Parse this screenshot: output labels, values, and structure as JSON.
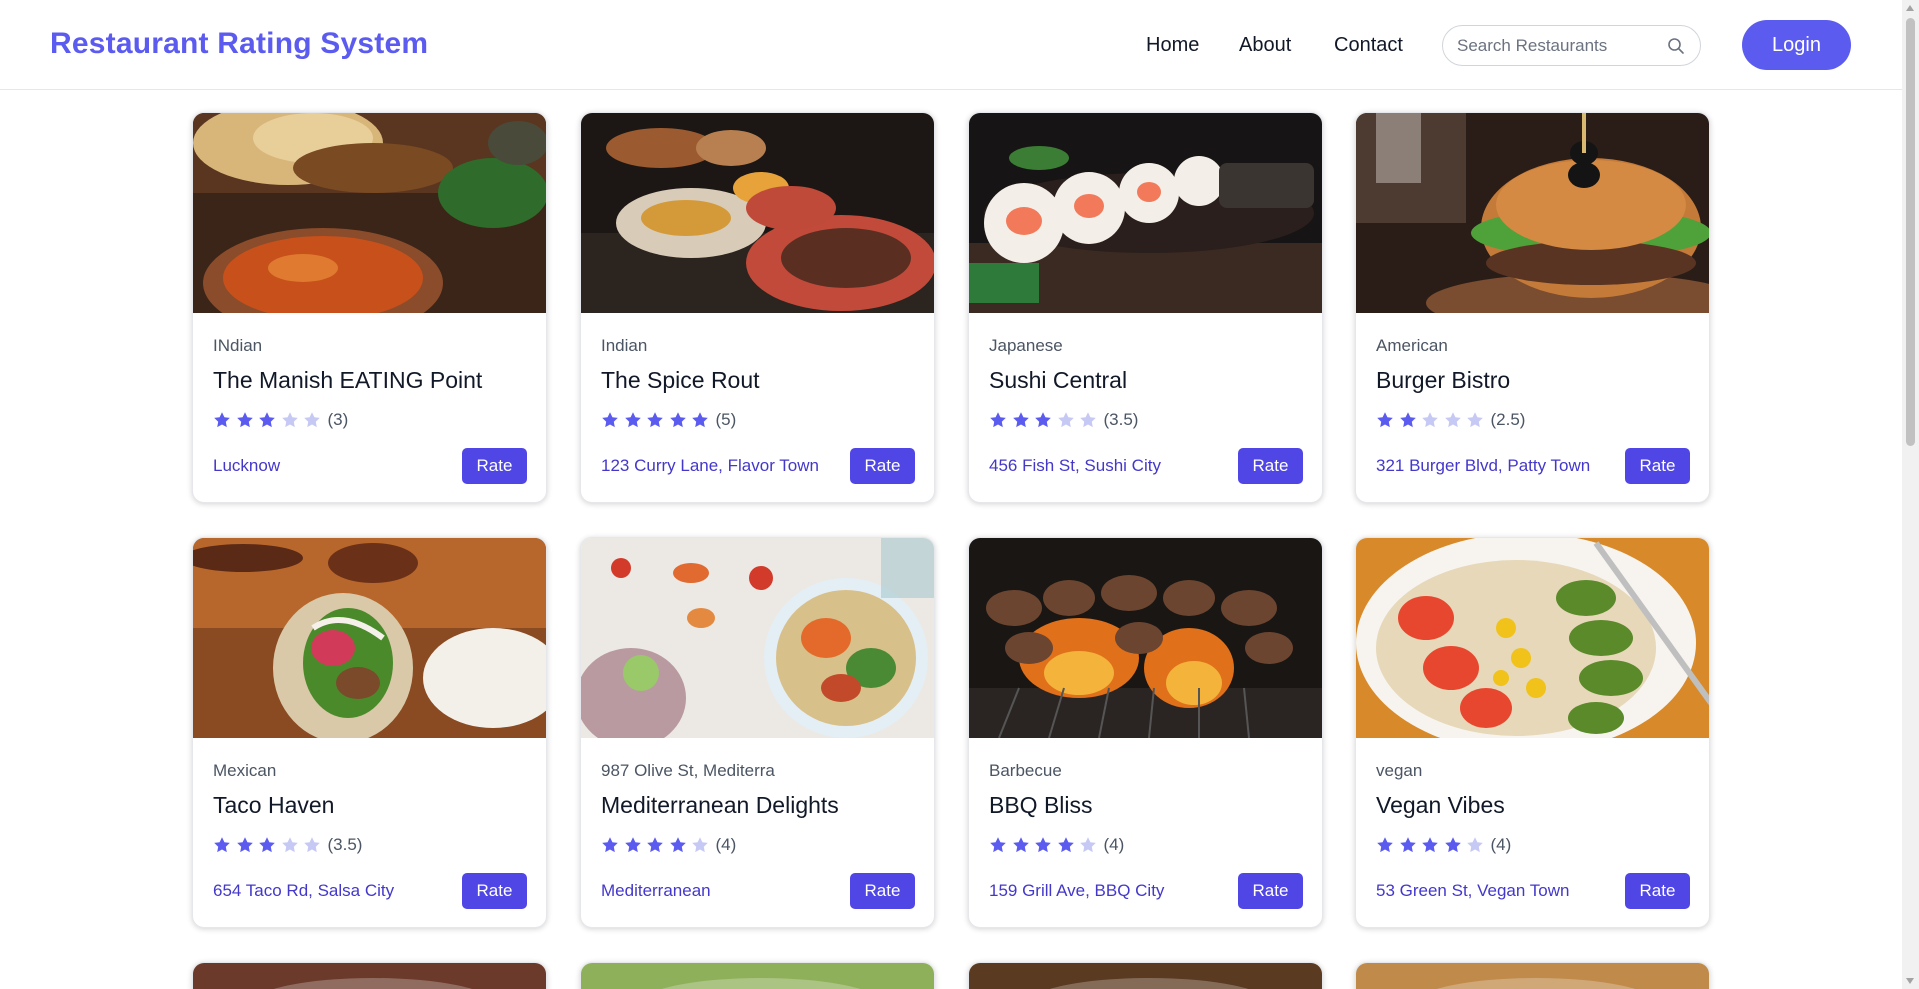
{
  "header": {
    "brand": "Restaurant Rating System",
    "nav": [
      "Home",
      "About",
      "Contact"
    ],
    "search_placeholder": "Search Restaurants",
    "login_label": "Login"
  },
  "colors": {
    "accent": "#5b5bf0",
    "button": "#4f46e5",
    "link": "#4338ca",
    "star_filled": "#5b5bf0",
    "star_empty": "#c7c9f5"
  },
  "restaurants": [
    {
      "cuisine": "INdian",
      "name": "The Manish EATING Point",
      "rating": 3,
      "rating_label": "(3)",
      "location": "Lucknow",
      "button": "Rate",
      "image": "naan-curry-photo"
    },
    {
      "cuisine": "Indian",
      "name": "The Spice Rout",
      "rating": 5,
      "rating_label": "(5)",
      "location": "123 Curry Lane, Flavor Town",
      "button": "Rate",
      "image": "indian-platter-photo"
    },
    {
      "cuisine": "Japanese",
      "name": "Sushi Central",
      "rating": 3.5,
      "rating_label": "(3.5)",
      "location": "456 Fish St, Sushi City",
      "button": "Rate",
      "image": "sushi-roll-photo"
    },
    {
      "cuisine": "American",
      "name": "Burger Bistro",
      "rating": 2.5,
      "rating_label": "(2.5)",
      "location": "321 Burger Blvd, Patty Town",
      "button": "Rate",
      "image": "burger-photo"
    },
    {
      "cuisine": "Mexican",
      "name": "Taco Haven",
      "rating": 3.5,
      "rating_label": "(3.5)",
      "location": "654 Taco Rd, Salsa City",
      "button": "Rate",
      "image": "taco-photo"
    },
    {
      "cuisine": "987 Olive St, Mediterra",
      "name": "Mediterranean Delights",
      "rating": 4,
      "rating_label": "(4)",
      "location": "Mediterranean",
      "button": "Rate",
      "image": "salad-bowl-photo"
    },
    {
      "cuisine": "Barbecue",
      "name": "BBQ Bliss",
      "rating": 4,
      "rating_label": "(4)",
      "location": "159 Grill Ave, BBQ City",
      "button": "Rate",
      "image": "grill-skewers-photo"
    },
    {
      "cuisine": "vegan",
      "name": "Vegan Vibes",
      "rating": 4,
      "rating_label": "(4)",
      "location": "53 Green St, Vegan Town",
      "button": "Rate",
      "image": "avocado-plate-photo"
    }
  ]
}
